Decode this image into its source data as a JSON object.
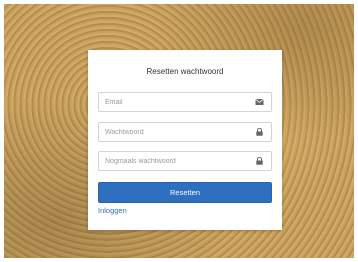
{
  "form": {
    "title": "Resetten wachtwoord",
    "email": {
      "placeholder": "Email",
      "icon": "envelope-icon"
    },
    "password": {
      "placeholder": "Wachtwoord",
      "icon": "lock-icon"
    },
    "password_repeat": {
      "placeholder": "Nogmaals wachtwoord",
      "icon": "lock-icon"
    },
    "submit_label": "Resetten",
    "login_link": "Inloggen"
  },
  "colors": {
    "accent": "#2f6fc0",
    "background": "#c29a58",
    "card": "#ffffff"
  }
}
